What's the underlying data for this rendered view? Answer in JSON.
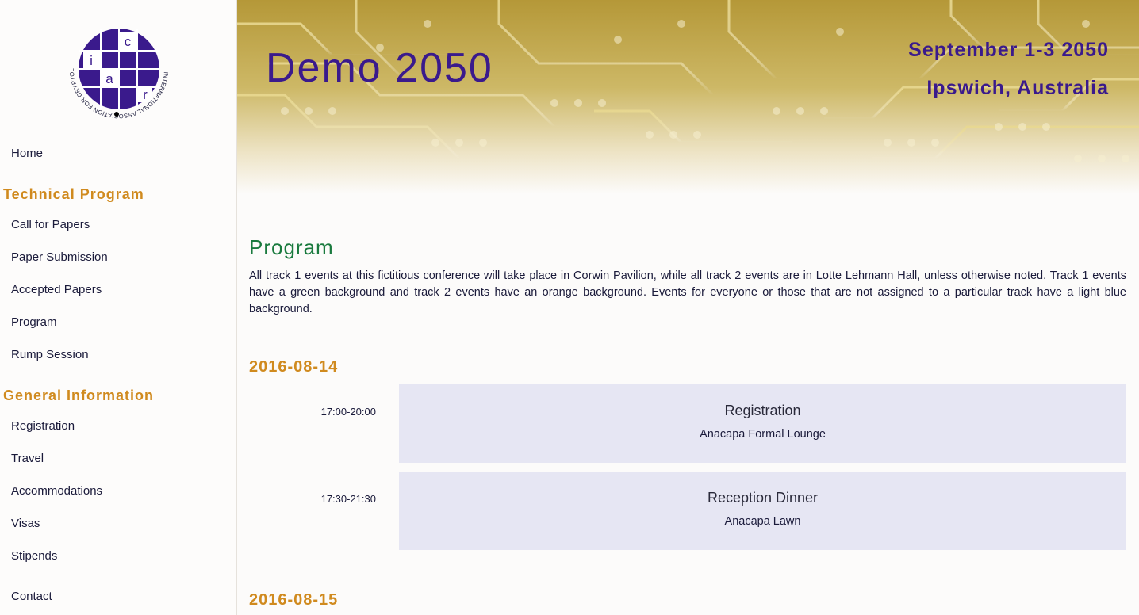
{
  "logo": {
    "ring_text": "INTERNATIONAL ASSOCIATION FOR CRYPTOLOGIC RESEARCH",
    "letters": [
      "i",
      "a",
      "c",
      "r"
    ],
    "color": "#3a1a8c"
  },
  "sidebar": {
    "home": "Home",
    "technical_program": {
      "heading": "Technical Program",
      "items": [
        "Call for Papers",
        "Paper Submission",
        "Accepted Papers",
        "Program",
        "Rump Session"
      ]
    },
    "general_information": {
      "heading": "General Information",
      "items": [
        "Registration",
        "Travel",
        "Accommodations",
        "Visas",
        "Stipends"
      ]
    },
    "contact": "Contact"
  },
  "header": {
    "title": "Demo 2050",
    "date": "September 1-3 2050",
    "location": "Ipswich, Australia",
    "background_icon": "circuit-board-pattern"
  },
  "main": {
    "title": "Program",
    "intro": "All track 1 events at this fictitious conference will take place in Corwin Pavilion, while all track 2 events are in Lotte Lehmann Hall, unless otherwise noted. Track 1 events have a green background and track 2 events have an orange background. Events for everyone or those that are not assigned to a particular track have a light blue background.",
    "days": [
      {
        "date": "2016-08-14",
        "events": [
          {
            "time": "17:00-20:00",
            "title": "Registration",
            "room": "Anacapa Formal Lounge"
          },
          {
            "time": "17:30-21:30",
            "title": "Reception Dinner",
            "room": "Anacapa Lawn"
          }
        ]
      },
      {
        "date": "2016-08-15",
        "events": []
      }
    ]
  },
  "colors": {
    "accent_purple": "#3a1a8c",
    "heading_orange": "#d08a1e",
    "program_green": "#1a7a3e",
    "event_light_blue": "#e6e6f3",
    "banner_gold": "#b89a3a"
  }
}
